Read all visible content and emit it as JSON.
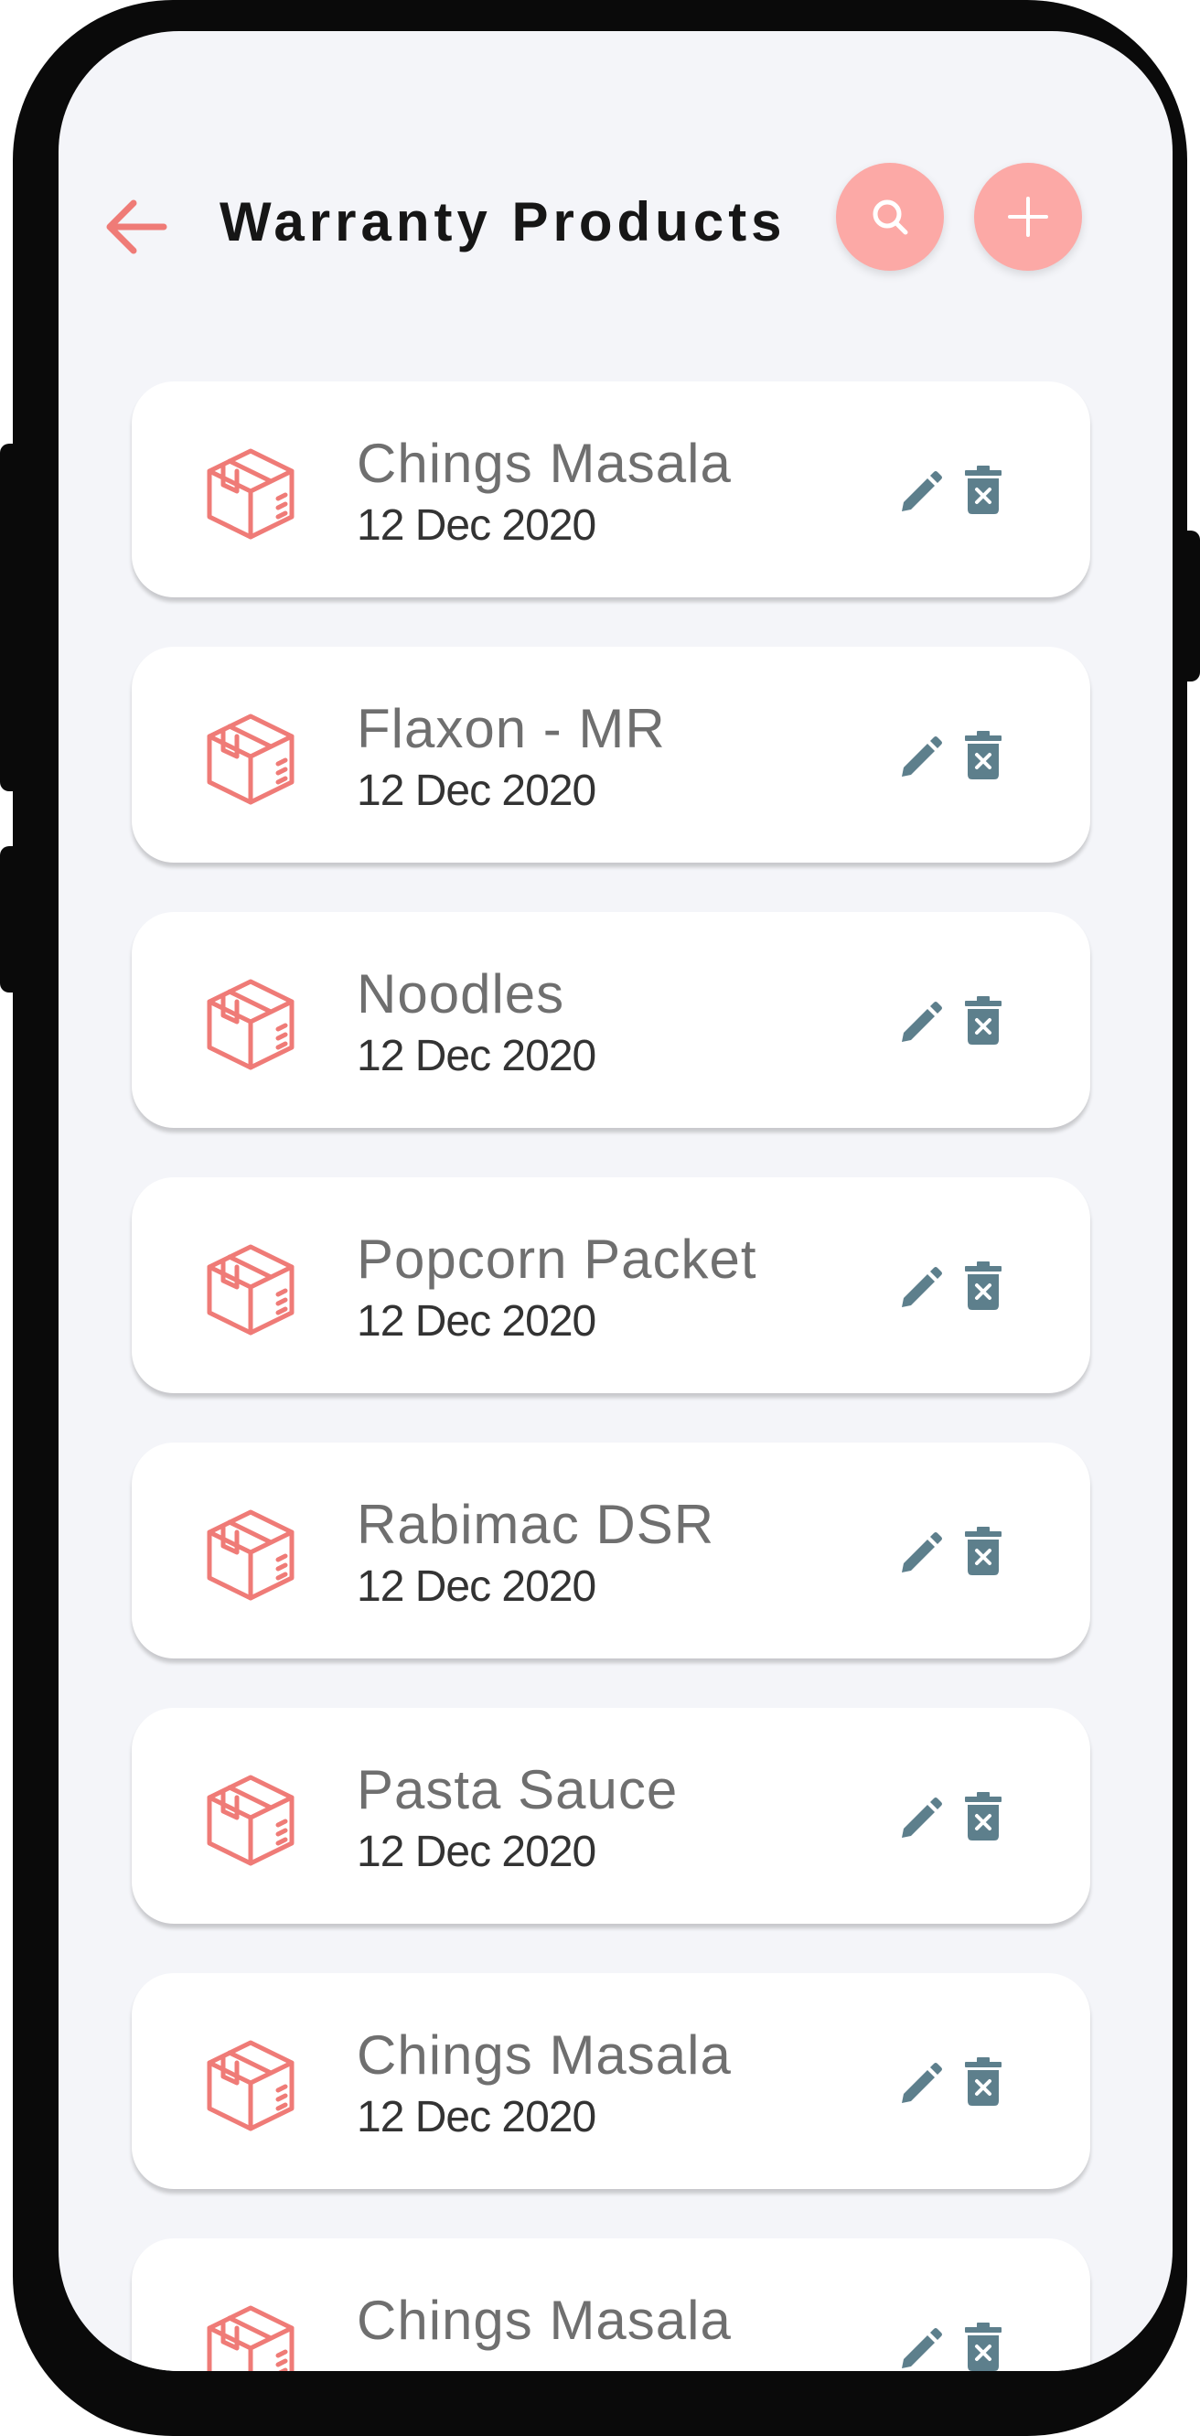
{
  "header": {
    "title": "Warranty Products",
    "back_icon": "arrow-left-icon",
    "search_icon": "search-icon",
    "add_icon": "plus-icon"
  },
  "colors": {
    "accent": "#ef7b77",
    "button_bg": "#fca9a6",
    "action_icon": "#5d7f8c",
    "screen_bg": "#f4f5f9"
  },
  "products": [
    {
      "name": "Chings Masala",
      "date": "12 Dec 2020"
    },
    {
      "name": "Flaxon - MR",
      "date": "12 Dec 2020"
    },
    {
      "name": "Noodles",
      "date": "12 Dec 2020"
    },
    {
      "name": "Popcorn Packet",
      "date": "12 Dec 2020"
    },
    {
      "name": "Rabimac DSR",
      "date": "12 Dec 2020"
    },
    {
      "name": "Pasta Sauce",
      "date": "12 Dec 2020"
    },
    {
      "name": "Chings Masala",
      "date": "12 Dec 2020"
    },
    {
      "name": "Chings Masala",
      "date": ""
    }
  ],
  "item_icons": {
    "product": "box-icon",
    "edit": "pencil-icon",
    "delete": "trash-icon"
  }
}
